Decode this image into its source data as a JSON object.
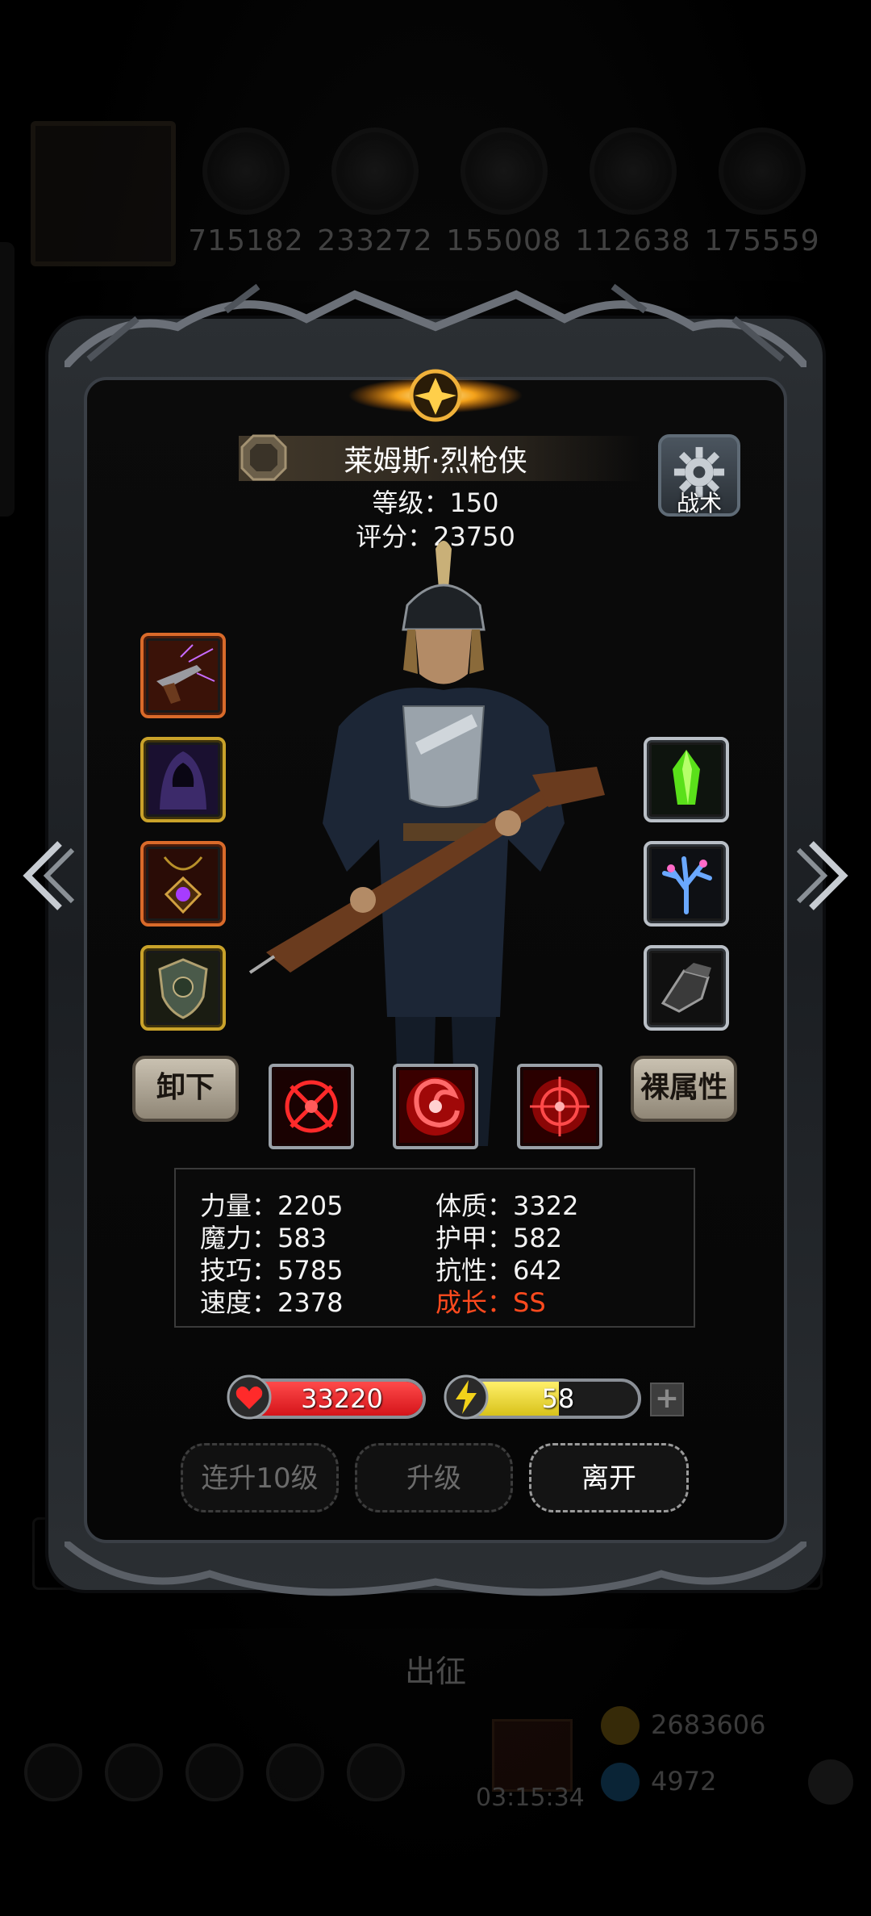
{
  "background": {
    "resources": [
      {
        "icon": "ore-icon",
        "value": "715182"
      },
      {
        "icon": "wood-icon",
        "value": "233272"
      },
      {
        "icon": "iron-icon",
        "value": "155008"
      },
      {
        "icon": "crystal-icon",
        "value": "112638"
      },
      {
        "icon": "stone-icon",
        "value": "175559"
      }
    ],
    "deploy_label": "出征",
    "timer": "03:15:34",
    "currencies": [
      {
        "icon": "gold-coin-icon",
        "value": "2683606"
      },
      {
        "icon": "gem-icon",
        "value": "4972"
      }
    ]
  },
  "hero": {
    "name": "莱姆斯·烈枪侠",
    "level": "等级：150",
    "score": "评分：23750",
    "tactics_label": "战术"
  },
  "equipment": {
    "left": [
      {
        "icon": "flintlock-pistol-icon",
        "rarity": "red"
      },
      {
        "icon": "hooded-cloak-icon",
        "rarity": "gold"
      },
      {
        "icon": "amulet-icon",
        "rarity": "red"
      },
      {
        "icon": "shield-icon",
        "rarity": "gold"
      }
    ],
    "right": [
      {
        "icon": "green-crystal-icon",
        "rarity": "silver"
      },
      {
        "icon": "coral-icon",
        "rarity": "silver"
      },
      {
        "icon": "gauntlet-icon",
        "rarity": "silver"
      }
    ]
  },
  "buttons": {
    "unequip": "卸下",
    "base_attributes": "裸属性",
    "level_up_10": "连升10级",
    "level_up": "升级",
    "leave": "离开"
  },
  "skills": [
    {
      "icon": "crosshair-rune-skill-icon"
    },
    {
      "icon": "red-vortex-skill-icon"
    },
    {
      "icon": "target-skill-icon"
    }
  ],
  "stats": {
    "strength": "力量：2205",
    "constitution": "体质：3322",
    "magic": "魔力：583",
    "armor": "护甲：582",
    "skill": "技巧：5785",
    "resistance": "抗性：642",
    "speed": "速度：2378",
    "growth": "成长：SS"
  },
  "bars": {
    "hp": {
      "value": "33220",
      "fill_percent": 100,
      "color": "#d4141a"
    },
    "energy": {
      "value": "58",
      "fill_percent": 58,
      "color": "#d8c21a"
    }
  },
  "colors": {
    "growth_text": "#ff4a1e",
    "frame_red": "#d96a2a",
    "frame_gold": "#c9a22a",
    "frame_silver": "#b9bfc6"
  }
}
